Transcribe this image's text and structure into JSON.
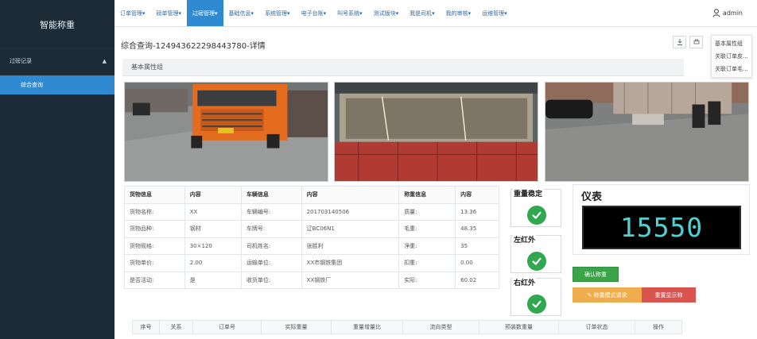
{
  "sidebar": {
    "brand": "智能称重",
    "group_label": "过磅记录",
    "group_chevron": "▲",
    "active_item": "综合查询"
  },
  "topnav": {
    "items": [
      {
        "label": "订单管理▾"
      },
      {
        "label": "磅单管理▾"
      },
      {
        "label": "过磅管理▾"
      },
      {
        "label": "基础信息▾"
      },
      {
        "label": "系统管理▾"
      },
      {
        "label": "电子台账▾"
      },
      {
        "label": "叫号系统▾"
      },
      {
        "label": "测试版块▾"
      },
      {
        "label": "我是司机▾"
      },
      {
        "label": "我的审核▾"
      },
      {
        "label": "运维管理▾"
      }
    ],
    "active_index": 2,
    "user": "admin"
  },
  "page": {
    "title": "综合查询-124943622298443780-详情",
    "section": "基本属性组"
  },
  "dropdown": {
    "items": [
      "基本属性组",
      "关联订单皮...",
      "关联订单毛..."
    ]
  },
  "info_table": {
    "headers": [
      "货物信息",
      "内容",
      "车辆信息",
      "内容",
      "称重信息",
      "内容"
    ],
    "rows": [
      [
        "货物名称:",
        "XX",
        "车辆编号:",
        "2017031405​06",
        "质量:",
        "13.36"
      ],
      [
        "货物品种:",
        "钢材",
        "车牌号:",
        "辽BC06N1",
        "毛重:",
        "48.35"
      ],
      [
        "货物规格:",
        "30×120",
        "司机姓名:",
        "张胜利",
        "净重:",
        "35"
      ],
      [
        "货物单价:",
        "2.00",
        "运输单位:",
        "XX市钢铁集团",
        "扣重:",
        "0.00"
      ],
      [
        "是否活动:",
        "是",
        "收货单位:",
        "XX钢铁厂",
        "实际:",
        "60.02"
      ]
    ]
  },
  "indicators": [
    {
      "label": "重量稳定"
    },
    {
      "label": "左红外"
    },
    {
      "label": "右红外"
    }
  ],
  "meter": {
    "title": "仪表",
    "value": "15550"
  },
  "buttons": {
    "confirm": "确认称重",
    "weigh_again": "✎ 称重模式请求",
    "restore": "重置显示称"
  },
  "bottom_table": {
    "headers": [
      "序号",
      "关系",
      "订单号",
      "实际重量",
      "重量增量比",
      "流向类型",
      "预装数重量",
      "订单状态",
      "操作"
    ]
  },
  "colors": {
    "sidebar_bg": "#1c2b36",
    "accent": "#2f8ad1",
    "success": "#39a448",
    "warning": "#f0ad4e",
    "danger": "#d9534f",
    "meter_text": "#4fd2d0"
  }
}
